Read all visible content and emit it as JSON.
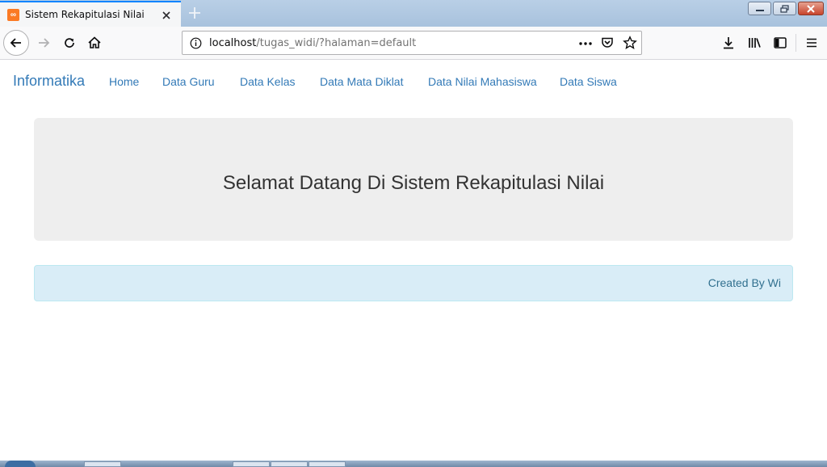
{
  "browser": {
    "tab_title": "Sistem Rekapitulasi Nilai",
    "url_host": "localhost",
    "url_path": "/tugas_widi/?halaman=default",
    "icons": [
      "back-icon",
      "forward-icon",
      "reload-icon",
      "home-icon",
      "info-icon",
      "more-icon",
      "pocket-icon",
      "bookmark-star-icon",
      "download-icon",
      "library-icon",
      "sidebar-icon",
      "menu-icon",
      "close-icon",
      "plus-icon"
    ]
  },
  "navbar": {
    "brand": "Informatika",
    "items": [
      "Home",
      "Data Guru",
      "Data Kelas",
      "Data Mata Diklat",
      "Data Nilai Mahasiswa",
      "Data Siswa"
    ]
  },
  "jumbotron": {
    "heading": "Selamat Datang Di Sistem Rekapitulasi Nilai"
  },
  "footer": {
    "text": "Created By Wi"
  },
  "colors": {
    "link": "#337ab7",
    "jumbotron_bg": "#eeeeee",
    "alert_bg": "#d9edf7",
    "alert_text": "#31708f",
    "tab_accent": "#0a84ff"
  }
}
